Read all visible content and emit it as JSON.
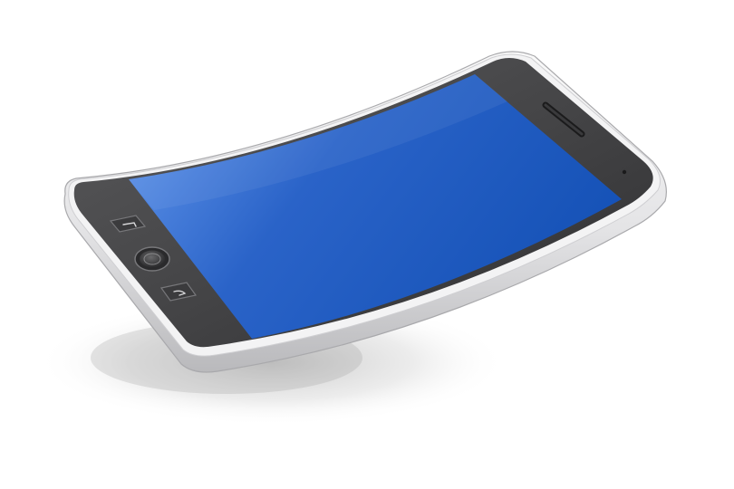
{
  "scene": {
    "background_color": "#ffffff",
    "subject": "curved-smartphone",
    "colors": {
      "frame": "#e9e9ea",
      "frame_edge": "#bdbdc0",
      "bezel": "#4a4a4c",
      "bezel_dark": "#2f2f31",
      "screen_light": "#4f86e3",
      "screen_dark": "#1551b8",
      "shadow": "#b9b9b9",
      "button": "#3c3c3e"
    },
    "icons": {
      "home_button": "home-button-icon",
      "back_button": "back-arrow-icon",
      "menu_button": "return-arrow-icon",
      "speaker": "speaker-grille-icon",
      "camera": "front-camera-icon"
    }
  }
}
